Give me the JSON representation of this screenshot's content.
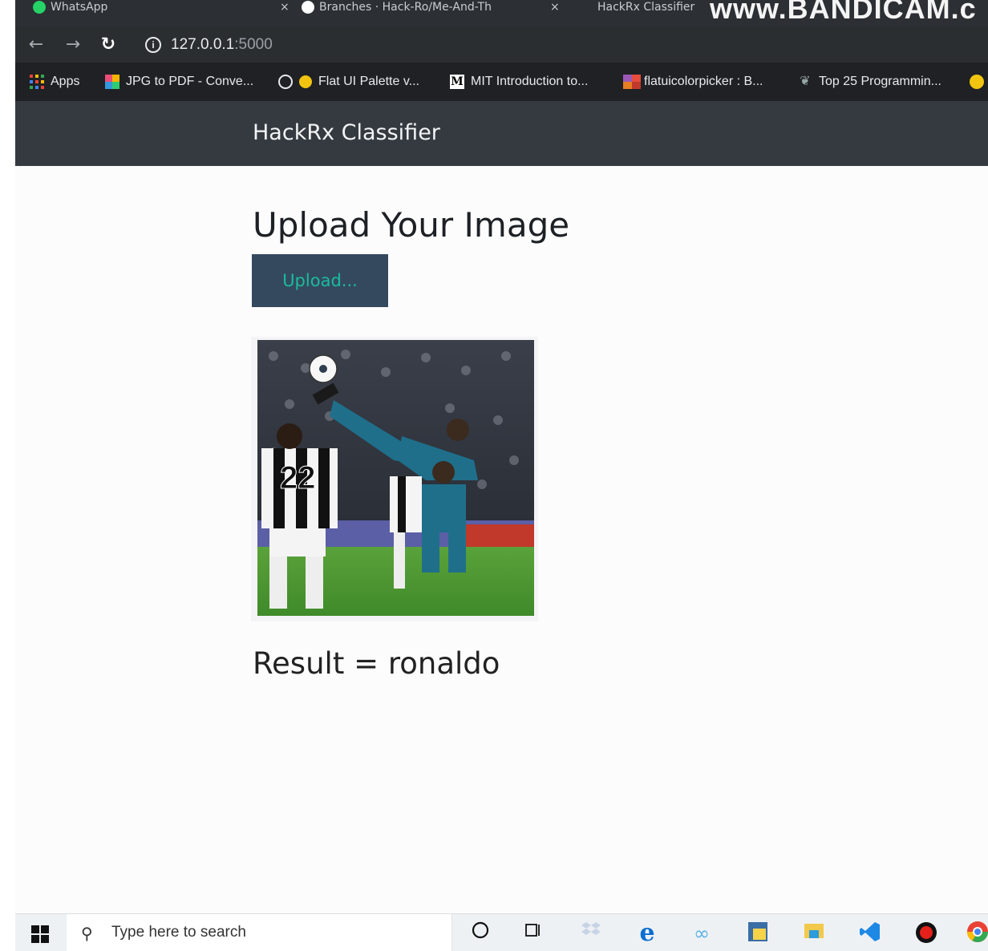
{
  "browser": {
    "tabs": [
      {
        "title": "WhatsApp",
        "close": "×"
      },
      {
        "title": "Branches · Hack-Ro/Me-And-Th",
        "close": "×"
      },
      {
        "title": "HackRx Classifier"
      }
    ],
    "watermark": "www.BANDICAM.c",
    "address": {
      "host": "127.0.0.1",
      "port": ":5000"
    },
    "bookmarks": [
      {
        "label": "Apps",
        "color": "#f4b400"
      },
      {
        "label": "JPG to PDF - Conve...",
        "color": "#e94e77"
      },
      {
        "label": "Flat UI Palette v...",
        "color": "#f1c40f"
      },
      {
        "label": "MIT Introduction to...",
        "color": "#ffffff"
      },
      {
        "label": "flatuicolorpicker : B...",
        "color": "#e74c3c"
      },
      {
        "label": "Top 25 Programmin...",
        "color": "#7f8c8d"
      }
    ]
  },
  "app": {
    "brand": "HackRx Classifier",
    "heading": "Upload Your Image",
    "upload_label": "Upload...",
    "result_text": "Result = ronaldo",
    "colors": {
      "navbar": "#343a40",
      "button_bg": "#34495e",
      "button_text": "#1abc9c"
    }
  },
  "taskbar": {
    "search_placeholder": "Type here to search"
  }
}
